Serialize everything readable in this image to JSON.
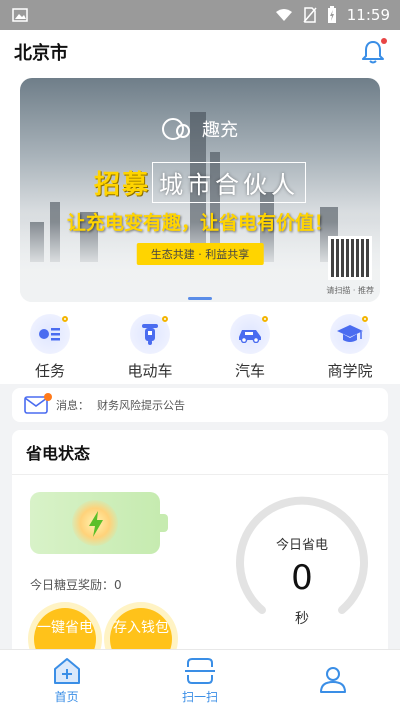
{
  "status_bar": {
    "time": "11:59",
    "icons": [
      "image-icon",
      "wifi-icon",
      "no-sim-icon",
      "battery-charging-icon"
    ]
  },
  "header": {
    "city": "北京市",
    "notification_icon": "bell-icon"
  },
  "banner": {
    "brand": "趣充",
    "headline_highlight": "招募",
    "headline_boxed": "城市合伙人",
    "slogan": "让充电变有趣，让省电有价值！",
    "pill": "生态共建 · 利益共享",
    "qr_caption": "请扫描 · 推荐"
  },
  "categories": [
    {
      "label": "任务",
      "icon": "task-list-icon"
    },
    {
      "label": "电动车",
      "icon": "ebike-icon"
    },
    {
      "label": "汽车",
      "icon": "car-icon"
    },
    {
      "label": "商学院",
      "icon": "graduation-cap-icon"
    }
  ],
  "notice": {
    "prefix": "消息：",
    "text": "财务风险提示公告"
  },
  "save_status": {
    "title": "省电状态",
    "reward": "今日糖豆奖励：0",
    "btn_save": "一键省电",
    "btn_deposit": "存入钱包",
    "gauge_label": "今日省电",
    "gauge_value": "0",
    "gauge_unit": "秒"
  },
  "tabbar": [
    {
      "label": "首页",
      "icon": "home-icon"
    },
    {
      "label": "扫一扫",
      "icon": "scan-icon"
    },
    {
      "label": "",
      "icon": "profile-icon"
    }
  ],
  "colors": {
    "accent": "#3a8ee6",
    "banner_yellow": "#ffd400",
    "button_yellow": "#ffc21a"
  }
}
